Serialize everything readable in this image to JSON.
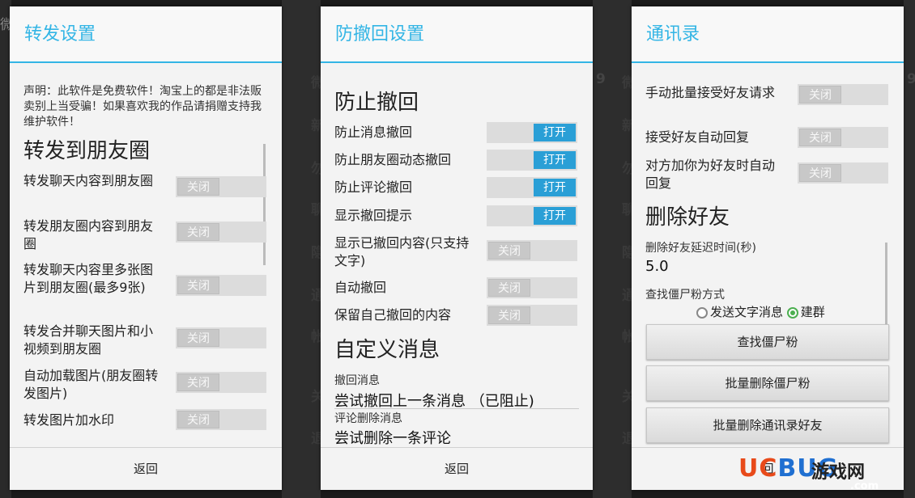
{
  "background": {
    "left_glyph": "微",
    "mid_rows": [
      "微",
      "新",
      "勿",
      "聊",
      "隐",
      "通",
      "帐",
      "关",
      "退"
    ],
    "mid_digit": "9",
    "right_rows": [
      "微",
      "新",
      "勿",
      "聊",
      "隐",
      "通",
      "帐",
      "关",
      "退"
    ],
    "right_digit": "9"
  },
  "panel1": {
    "title": "转发设置",
    "notice": "声明：此软件是免费软件！淘宝上的都是非法贩卖别上当受骗！如果喜欢我的作品请捐赠支持我维护软件！",
    "heading": "转发到朋友圈",
    "items": [
      {
        "label": "转发聊天内容到朋友圈",
        "toggle": "关闭",
        "on": false
      },
      {
        "label": "转发朋友圈内容到朋友圈",
        "toggle": "关闭",
        "on": false
      },
      {
        "label": "转发聊天内容里多张图片到朋友圈(最多9张)",
        "toggle": "关闭",
        "on": false
      },
      {
        "label": "转发合并聊天图片和小视频到朋友圈",
        "toggle": "关闭",
        "on": false
      },
      {
        "label": "自动加载图片(朋友圈转发图片)",
        "toggle": "关闭",
        "on": false
      },
      {
        "label": "转发图片加水印",
        "toggle": "关闭",
        "on": false
      }
    ],
    "footer": "返回"
  },
  "panel2": {
    "title": "防撤回设置",
    "heading1": "防止撤回",
    "items": [
      {
        "label": "防止消息撤回",
        "toggle": "打开",
        "on": true
      },
      {
        "label": "防止朋友圈动态撤回",
        "toggle": "打开",
        "on": true
      },
      {
        "label": "防止评论撤回",
        "toggle": "打开",
        "on": true
      },
      {
        "label": "显示撤回提示",
        "toggle": "打开",
        "on": true
      },
      {
        "label": "显示已撤回内容(只支持文字)",
        "toggle": "关闭",
        "on": false
      },
      {
        "label": "自动撤回",
        "toggle": "关闭",
        "on": false
      },
      {
        "label": "保留自己撤回的内容",
        "toggle": "关闭",
        "on": false
      }
    ],
    "heading2": "自定义消息",
    "field1_label": "撤回消息",
    "field1_value": "尝试撤回上一条消息 （已阻止)",
    "field2_label": "评论删除消息",
    "field2_value": "尝试删除一条评论",
    "footer": "返回"
  },
  "panel3": {
    "title": "通讯录",
    "items": [
      {
        "label": "手动批量接受好友请求",
        "toggle": "关闭",
        "on": false
      },
      {
        "label": "接受好友自动回复",
        "toggle": "关闭",
        "on": false
      },
      {
        "label": "对方加你为好友时自动回复",
        "toggle": "关闭",
        "on": false
      }
    ],
    "heading": "删除好友",
    "delay_label": "删除好友延迟时间(秒)",
    "delay_value": "5.0",
    "method_label": "查找僵尸粉方式",
    "radio1": "发送文字消息",
    "radio2": "建群",
    "btn1": "查找僵尸粉",
    "btn2": "批量删除僵尸粉",
    "btn3": "批量删除通讯录好友",
    "footer": "回"
  },
  "watermark": {
    "part1": "UC",
    "part2": "BUG",
    "part3": "游戏网",
    "part4": ".com"
  },
  "colors": {
    "accent": "#33b5e5",
    "toggle_on": "#2a9fd6"
  }
}
